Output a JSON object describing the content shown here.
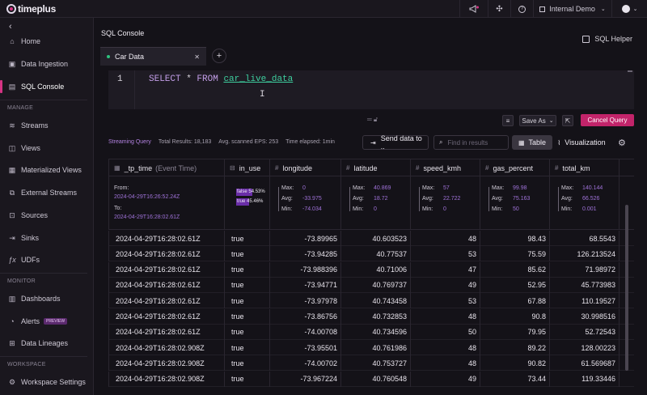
{
  "app": {
    "logo_text": "timeplus"
  },
  "topbar": {
    "workspace": "Internal Demo"
  },
  "sidebar": {
    "items": [
      {
        "label": "Home",
        "icon": "home-icon"
      },
      {
        "label": "Data Ingestion",
        "icon": "ingestion-icon"
      },
      {
        "label": "SQL Console",
        "icon": "sql-icon"
      }
    ],
    "manage_label": "MANAGE",
    "manage_items": [
      {
        "label": "Streams",
        "icon": "streams-icon"
      },
      {
        "label": "Views",
        "icon": "view-icon"
      },
      {
        "label": "Materialized Views",
        "icon": "materialized-view-icon"
      },
      {
        "label": "External Streams",
        "icon": "external-streams-icon"
      },
      {
        "label": "Sources",
        "icon": "sources-icon"
      },
      {
        "label": "Sinks",
        "icon": "sinks-icon"
      },
      {
        "label": "UDFs",
        "icon": "function-icon"
      }
    ],
    "monitor_label": "MONITOR",
    "monitor_items": [
      {
        "label": "Dashboards",
        "icon": "dashboard-icon"
      },
      {
        "label": "Alerts",
        "icon": "alert-icon",
        "badge": "PREVIEW"
      },
      {
        "label": "Data Lineages",
        "icon": "lineage-icon"
      }
    ],
    "workspace_label": "WORKSPACE",
    "workspace_items": [
      {
        "label": "Workspace Settings",
        "icon": "gear-icon"
      }
    ]
  },
  "page": {
    "title": "SQL Console",
    "sql_helper": "SQL Helper"
  },
  "tab": {
    "label": "Car Data"
  },
  "editor": {
    "line_number": "1",
    "kw_select": "SELECT",
    "star": " * ",
    "kw_from": "FROM",
    "table": "car_live_data"
  },
  "toolbar": {
    "save_as": "Save As",
    "cancel": "Cancel Query"
  },
  "stats": {
    "mode": "Streaming Query",
    "total": "Total Results: 18,183",
    "eps": "Avg. scanned EPS: 253",
    "elapsed": "Time elapsed: 1min"
  },
  "actions": {
    "send": "Send data to ..",
    "find_placeholder": "Find in results",
    "table": "Table",
    "viz": "Visualization"
  },
  "columns": [
    {
      "name": "_tp_time",
      "sub": "(Event Time)",
      "icon": "calendar-icon"
    },
    {
      "name": "in_use",
      "sub": "",
      "icon": "boolean-icon"
    },
    {
      "name": "longitude",
      "sub": "",
      "icon": "hash-icon"
    },
    {
      "name": "latitude",
      "sub": "",
      "icon": "hash-icon"
    },
    {
      "name": "speed_kmh",
      "sub": "",
      "icon": "hash-icon"
    },
    {
      "name": "gas_percent",
      "sub": "",
      "icon": "hash-icon"
    },
    {
      "name": "total_km",
      "sub": "",
      "icon": "hash-icon"
    }
  ],
  "summary": {
    "time_from_label": "From:",
    "time_from": "2024-04-29T16:26:52.24Z",
    "time_to_label": "To:",
    "time_to": "2024-04-29T16:28:02.61Z",
    "in_use": [
      {
        "label": "false",
        "pct": "54.53%",
        "frac": 0.5453
      },
      {
        "label": "true",
        "pct": "45.46%",
        "frac": 0.4546
      }
    ],
    "labels": {
      "max": "Max:",
      "avg": "Avg:",
      "min": "Min:"
    },
    "longitude": {
      "max": "0",
      "avg": "-33.975",
      "min": "-74.034"
    },
    "latitude": {
      "max": "40.869",
      "avg": "18.72",
      "min": "0"
    },
    "speed_kmh": {
      "max": "57",
      "avg": "22.722",
      "min": "0"
    },
    "gas_percent": {
      "max": "99.98",
      "avg": "75.163",
      "min": "50"
    },
    "total_km": {
      "max": "140.144",
      "avg": "66.526",
      "min": "0.001"
    }
  },
  "rows": [
    [
      "2024-04-29T16:28:02.61Z",
      "true",
      "-73.89965",
      "40.603523",
      "48",
      "98.43",
      "68.5543"
    ],
    [
      "2024-04-29T16:28:02.61Z",
      "true",
      "-73.94285",
      "40.77537",
      "53",
      "75.59",
      "126.213524"
    ],
    [
      "2024-04-29T16:28:02.61Z",
      "true",
      "-73.988396",
      "40.71006",
      "47",
      "85.62",
      "71.98972"
    ],
    [
      "2024-04-29T16:28:02.61Z",
      "true",
      "-73.94771",
      "40.769737",
      "49",
      "52.95",
      "45.773983"
    ],
    [
      "2024-04-29T16:28:02.61Z",
      "true",
      "-73.97978",
      "40.743458",
      "53",
      "67.88",
      "110.19527"
    ],
    [
      "2024-04-29T16:28:02.61Z",
      "true",
      "-73.86756",
      "40.732853",
      "48",
      "90.8",
      "30.998516"
    ],
    [
      "2024-04-29T16:28:02.61Z",
      "true",
      "-74.00708",
      "40.734596",
      "50",
      "79.95",
      "52.72543"
    ],
    [
      "2024-04-29T16:28:02.908Z",
      "true",
      "-73.95501",
      "40.761986",
      "48",
      "89.22",
      "128.00223"
    ],
    [
      "2024-04-29T16:28:02.908Z",
      "true",
      "-74.00702",
      "40.753727",
      "48",
      "90.82",
      "61.569687"
    ],
    [
      "2024-04-29T16:28:02.908Z",
      "true",
      "-73.967224",
      "40.760548",
      "49",
      "73.44",
      "119.33446"
    ]
  ],
  "colors": {
    "accent": "#d63384",
    "purple": "#9f72d8",
    "live": "#2ec27e"
  }
}
